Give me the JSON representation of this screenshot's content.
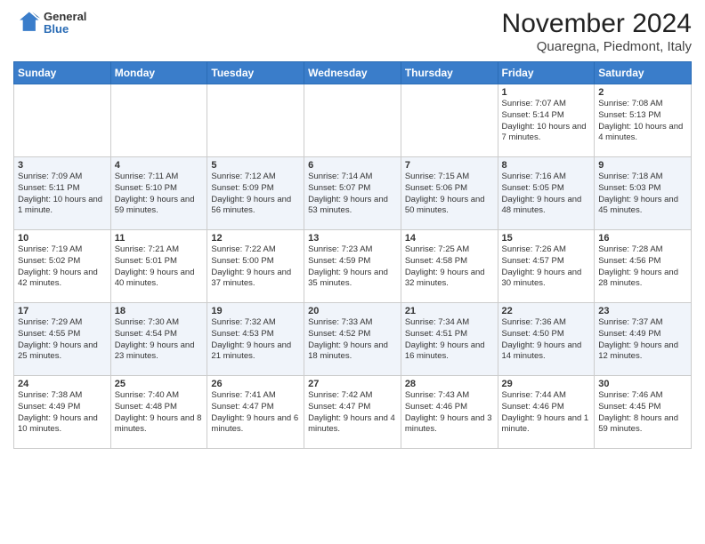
{
  "header": {
    "logo_general": "General",
    "logo_blue": "Blue",
    "month_title": "November 2024",
    "subtitle": "Quaregna, Piedmont, Italy"
  },
  "weekdays": [
    "Sunday",
    "Monday",
    "Tuesday",
    "Wednesday",
    "Thursday",
    "Friday",
    "Saturday"
  ],
  "weeks": [
    [
      {
        "day": "",
        "info": ""
      },
      {
        "day": "",
        "info": ""
      },
      {
        "day": "",
        "info": ""
      },
      {
        "day": "",
        "info": ""
      },
      {
        "day": "",
        "info": ""
      },
      {
        "day": "1",
        "info": "Sunrise: 7:07 AM\nSunset: 5:14 PM\nDaylight: 10 hours and 7 minutes."
      },
      {
        "day": "2",
        "info": "Sunrise: 7:08 AM\nSunset: 5:13 PM\nDaylight: 10 hours and 4 minutes."
      }
    ],
    [
      {
        "day": "3",
        "info": "Sunrise: 7:09 AM\nSunset: 5:11 PM\nDaylight: 10 hours and 1 minute."
      },
      {
        "day": "4",
        "info": "Sunrise: 7:11 AM\nSunset: 5:10 PM\nDaylight: 9 hours and 59 minutes."
      },
      {
        "day": "5",
        "info": "Sunrise: 7:12 AM\nSunset: 5:09 PM\nDaylight: 9 hours and 56 minutes."
      },
      {
        "day": "6",
        "info": "Sunrise: 7:14 AM\nSunset: 5:07 PM\nDaylight: 9 hours and 53 minutes."
      },
      {
        "day": "7",
        "info": "Sunrise: 7:15 AM\nSunset: 5:06 PM\nDaylight: 9 hours and 50 minutes."
      },
      {
        "day": "8",
        "info": "Sunrise: 7:16 AM\nSunset: 5:05 PM\nDaylight: 9 hours and 48 minutes."
      },
      {
        "day": "9",
        "info": "Sunrise: 7:18 AM\nSunset: 5:03 PM\nDaylight: 9 hours and 45 minutes."
      }
    ],
    [
      {
        "day": "10",
        "info": "Sunrise: 7:19 AM\nSunset: 5:02 PM\nDaylight: 9 hours and 42 minutes."
      },
      {
        "day": "11",
        "info": "Sunrise: 7:21 AM\nSunset: 5:01 PM\nDaylight: 9 hours and 40 minutes."
      },
      {
        "day": "12",
        "info": "Sunrise: 7:22 AM\nSunset: 5:00 PM\nDaylight: 9 hours and 37 minutes."
      },
      {
        "day": "13",
        "info": "Sunrise: 7:23 AM\nSunset: 4:59 PM\nDaylight: 9 hours and 35 minutes."
      },
      {
        "day": "14",
        "info": "Sunrise: 7:25 AM\nSunset: 4:58 PM\nDaylight: 9 hours and 32 minutes."
      },
      {
        "day": "15",
        "info": "Sunrise: 7:26 AM\nSunset: 4:57 PM\nDaylight: 9 hours and 30 minutes."
      },
      {
        "day": "16",
        "info": "Sunrise: 7:28 AM\nSunset: 4:56 PM\nDaylight: 9 hours and 28 minutes."
      }
    ],
    [
      {
        "day": "17",
        "info": "Sunrise: 7:29 AM\nSunset: 4:55 PM\nDaylight: 9 hours and 25 minutes."
      },
      {
        "day": "18",
        "info": "Sunrise: 7:30 AM\nSunset: 4:54 PM\nDaylight: 9 hours and 23 minutes."
      },
      {
        "day": "19",
        "info": "Sunrise: 7:32 AM\nSunset: 4:53 PM\nDaylight: 9 hours and 21 minutes."
      },
      {
        "day": "20",
        "info": "Sunrise: 7:33 AM\nSunset: 4:52 PM\nDaylight: 9 hours and 18 minutes."
      },
      {
        "day": "21",
        "info": "Sunrise: 7:34 AM\nSunset: 4:51 PM\nDaylight: 9 hours and 16 minutes."
      },
      {
        "day": "22",
        "info": "Sunrise: 7:36 AM\nSunset: 4:50 PM\nDaylight: 9 hours and 14 minutes."
      },
      {
        "day": "23",
        "info": "Sunrise: 7:37 AM\nSunset: 4:49 PM\nDaylight: 9 hours and 12 minutes."
      }
    ],
    [
      {
        "day": "24",
        "info": "Sunrise: 7:38 AM\nSunset: 4:49 PM\nDaylight: 9 hours and 10 minutes."
      },
      {
        "day": "25",
        "info": "Sunrise: 7:40 AM\nSunset: 4:48 PM\nDaylight: 9 hours and 8 minutes."
      },
      {
        "day": "26",
        "info": "Sunrise: 7:41 AM\nSunset: 4:47 PM\nDaylight: 9 hours and 6 minutes."
      },
      {
        "day": "27",
        "info": "Sunrise: 7:42 AM\nSunset: 4:47 PM\nDaylight: 9 hours and 4 minutes."
      },
      {
        "day": "28",
        "info": "Sunrise: 7:43 AM\nSunset: 4:46 PM\nDaylight: 9 hours and 3 minutes."
      },
      {
        "day": "29",
        "info": "Sunrise: 7:44 AM\nSunset: 4:46 PM\nDaylight: 9 hours and 1 minute."
      },
      {
        "day": "30",
        "info": "Sunrise: 7:46 AM\nSunset: 4:45 PM\nDaylight: 8 hours and 59 minutes."
      }
    ]
  ]
}
